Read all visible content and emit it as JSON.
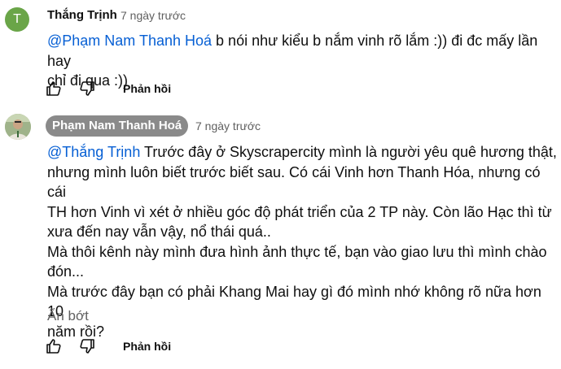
{
  "comment1": {
    "avatar_letter": "T",
    "author": "Thắng Trịnh",
    "time": "7 ngày trước",
    "mention": "@Phạm Nam Thanh Hoá",
    "text_line1": " b nói như kiểu b nắm vinh rõ lắm :)) đi đc mấy lần hay",
    "text_line2": "chỉ đi qua :))",
    "reply_label": "Phản hồi",
    "like_icon": "thumbs-up-icon",
    "dislike_icon": "thumbs-down-icon"
  },
  "comment2": {
    "author": "Phạm Nam Thanh Hoá",
    "time": "7 ngày trước",
    "mention": "@Thắng Trịnh",
    "lines": [
      " Trước đây ở Skyscrapercity mình là người yêu quê hương thật,",
      "nhưng mình luôn biết trước biết sau. Có cái Vinh hơn Thanh Hóa, nhưng có cái",
      "TH hơn Vinh vì xét ở nhiều góc độ phát triển của 2 TP này. Còn lão Hạc thì từ",
      "xưa đến nay vẫn vậy, nổ thái quá..",
      "Mà thôi kênh này mình đưa hình ảnh thực tế, bạn vào giao lưu thì mình chào",
      "đón...",
      "Mà trước đây bạn có phải Khang Mai hay gì đó mình nhớ không rõ nữa hơn 10",
      "năm rồi?"
    ],
    "show_less_label": "Ẩn bớt",
    "reply_label": "Phản hồi",
    "like_icon": "thumbs-up-icon",
    "dislike_icon": "thumbs-down-icon"
  },
  "colors": {
    "mention": "#065fd4",
    "avatar_t": "#6aa548",
    "pill": "#8a8a8a",
    "secondary_text": "#606060"
  }
}
